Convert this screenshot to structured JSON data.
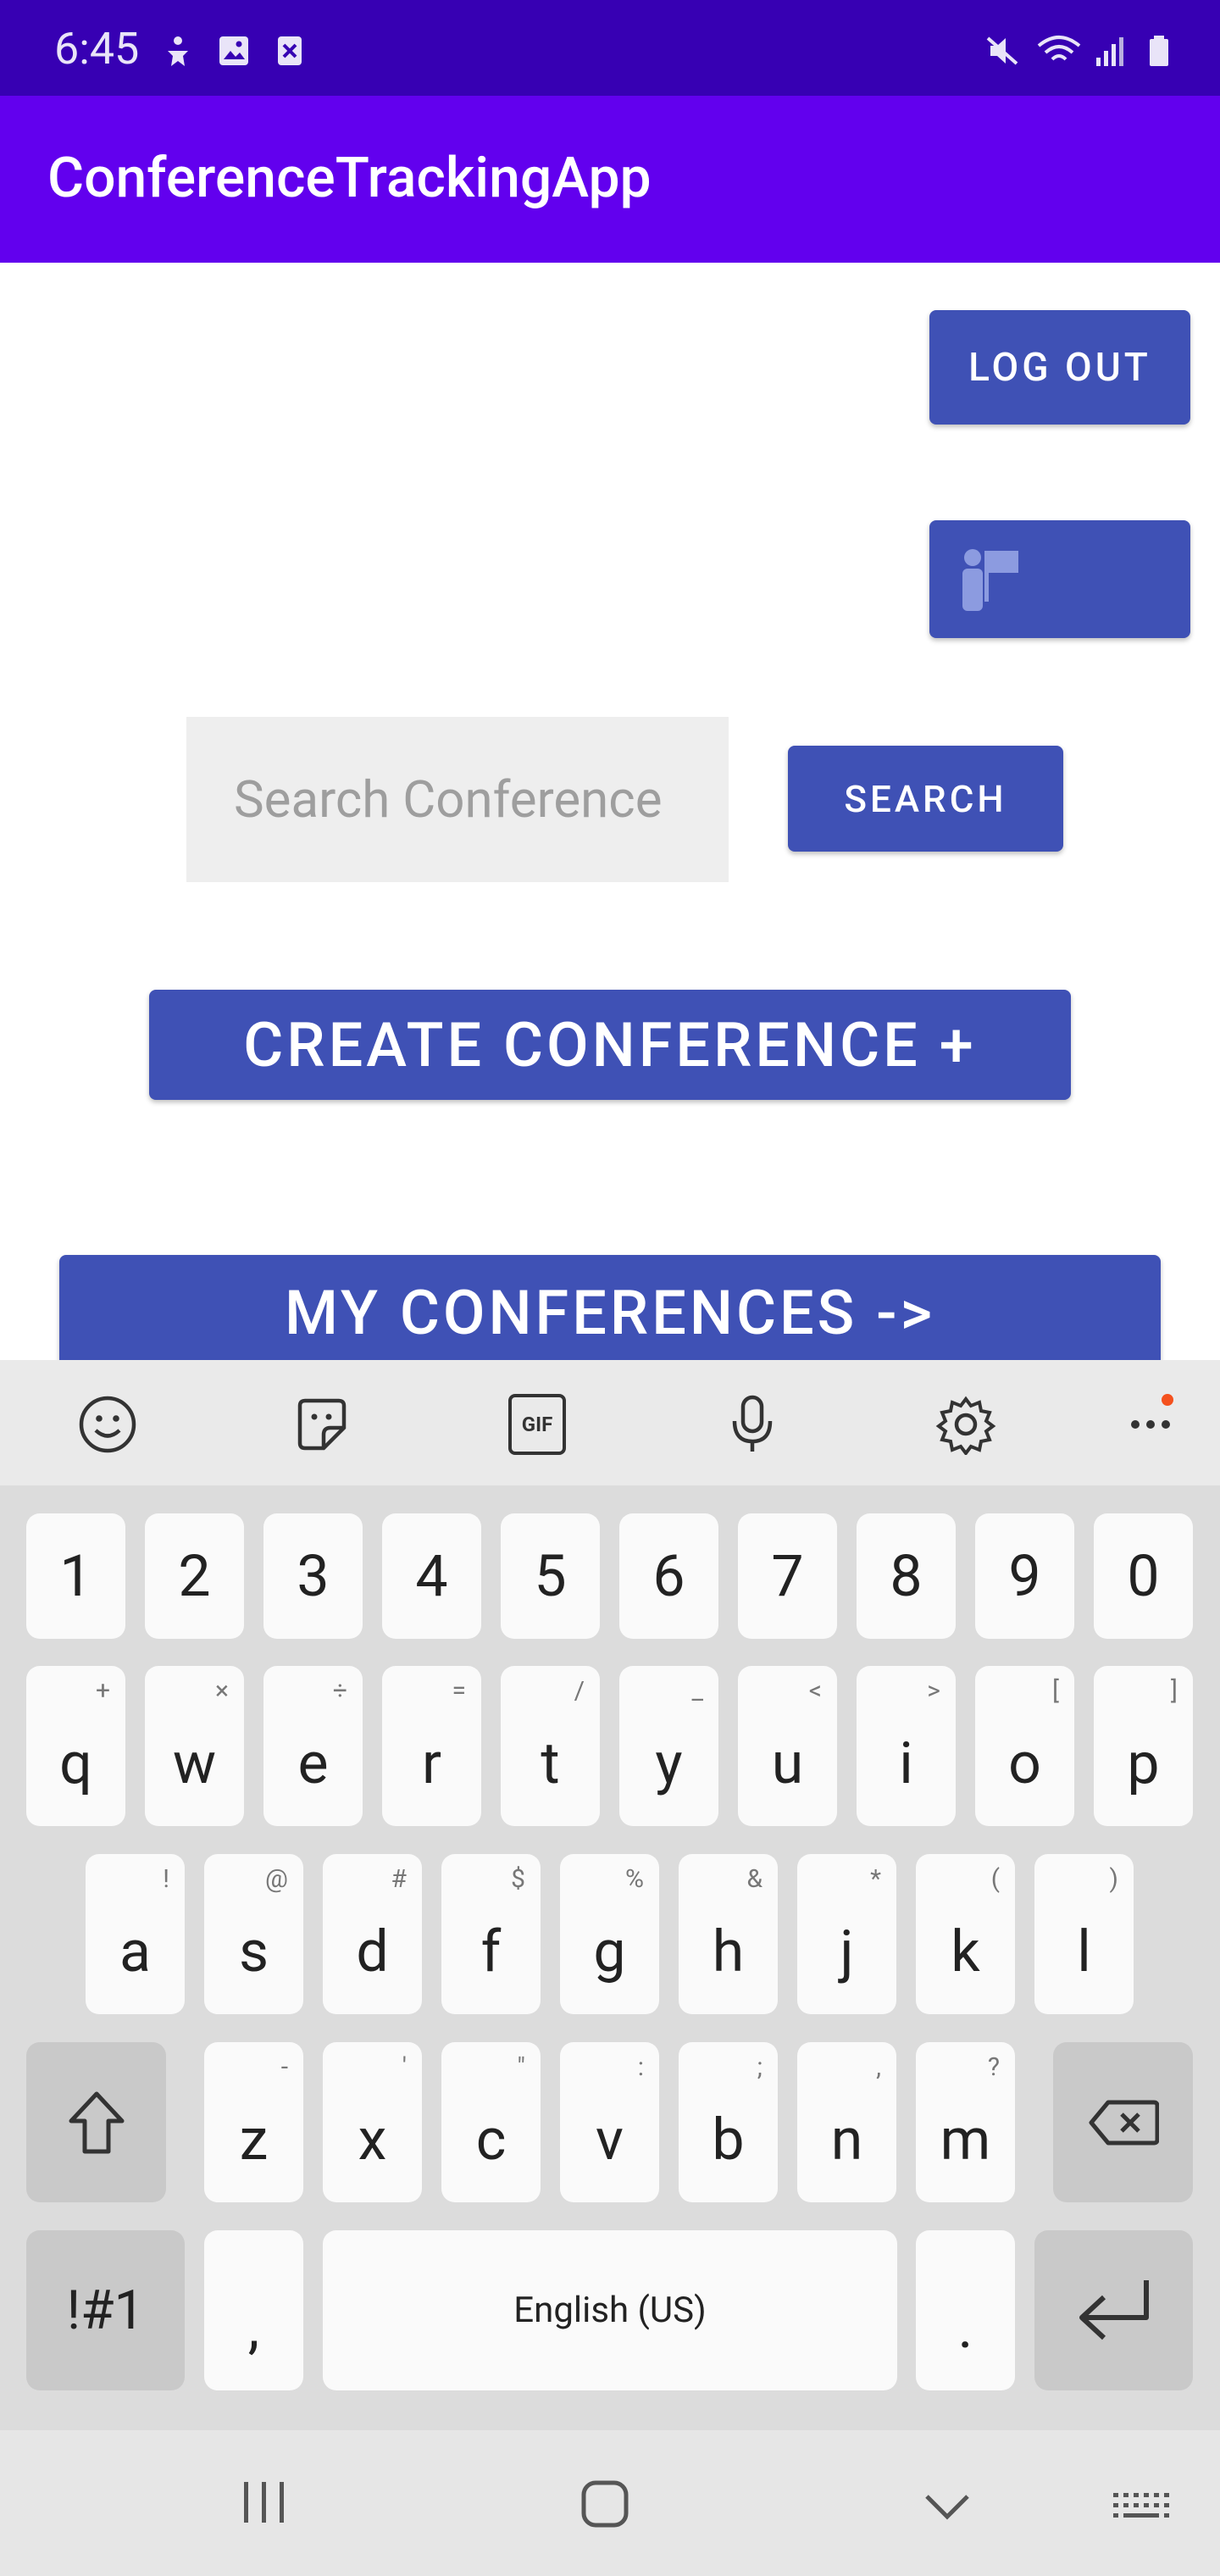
{
  "status_bar": {
    "time": "6:45"
  },
  "app_bar": {
    "title": "ConferenceTrackingApp"
  },
  "main": {
    "logout_label": "LOG OUT",
    "search_placeholder": "Search Conference",
    "search_label": "SEARCH",
    "create_label": "CREATE CONFERENCE +",
    "my_conferences_label": "MY CONFERENCES ->"
  },
  "keyboard": {
    "toolbar_icons": [
      "emoji-icon",
      "sticker-icon",
      "gif-icon",
      "mic-icon",
      "settings-icon",
      "more-icon"
    ],
    "gif_label": "GIF",
    "row_numbers": [
      "1",
      "2",
      "3",
      "4",
      "5",
      "6",
      "7",
      "8",
      "9",
      "0"
    ],
    "row_top": [
      {
        "key": "q",
        "hint": "+"
      },
      {
        "key": "w",
        "hint": "×"
      },
      {
        "key": "e",
        "hint": "÷"
      },
      {
        "key": "r",
        "hint": "="
      },
      {
        "key": "t",
        "hint": "/"
      },
      {
        "key": "y",
        "hint": "_"
      },
      {
        "key": "u",
        "hint": "<"
      },
      {
        "key": "i",
        "hint": ">"
      },
      {
        "key": "o",
        "hint": "["
      },
      {
        "key": "p",
        "hint": "]"
      }
    ],
    "row_middle": [
      {
        "key": "a",
        "hint": "!"
      },
      {
        "key": "s",
        "hint": "@"
      },
      {
        "key": "d",
        "hint": "#"
      },
      {
        "key": "f",
        "hint": "$"
      },
      {
        "key": "g",
        "hint": "%"
      },
      {
        "key": "h",
        "hint": "&"
      },
      {
        "key": "j",
        "hint": "*"
      },
      {
        "key": "k",
        "hint": "("
      },
      {
        "key": "l",
        "hint": ")"
      }
    ],
    "row_bottom": [
      {
        "key": "z",
        "hint": "-"
      },
      {
        "key": "x",
        "hint": "'"
      },
      {
        "key": "c",
        "hint": "\""
      },
      {
        "key": "v",
        "hint": ":"
      },
      {
        "key": "b",
        "hint": ";"
      },
      {
        "key": "n",
        "hint": ","
      },
      {
        "key": "m",
        "hint": "?"
      }
    ],
    "symbols_label": "!#1",
    "comma_label": ",",
    "space_label": "English (US)",
    "period_label": "."
  },
  "colors": {
    "status_bar": "#3700B3",
    "app_bar": "#6200EE",
    "button": "#3F51B5",
    "notification_dot": "#F4511E"
  }
}
